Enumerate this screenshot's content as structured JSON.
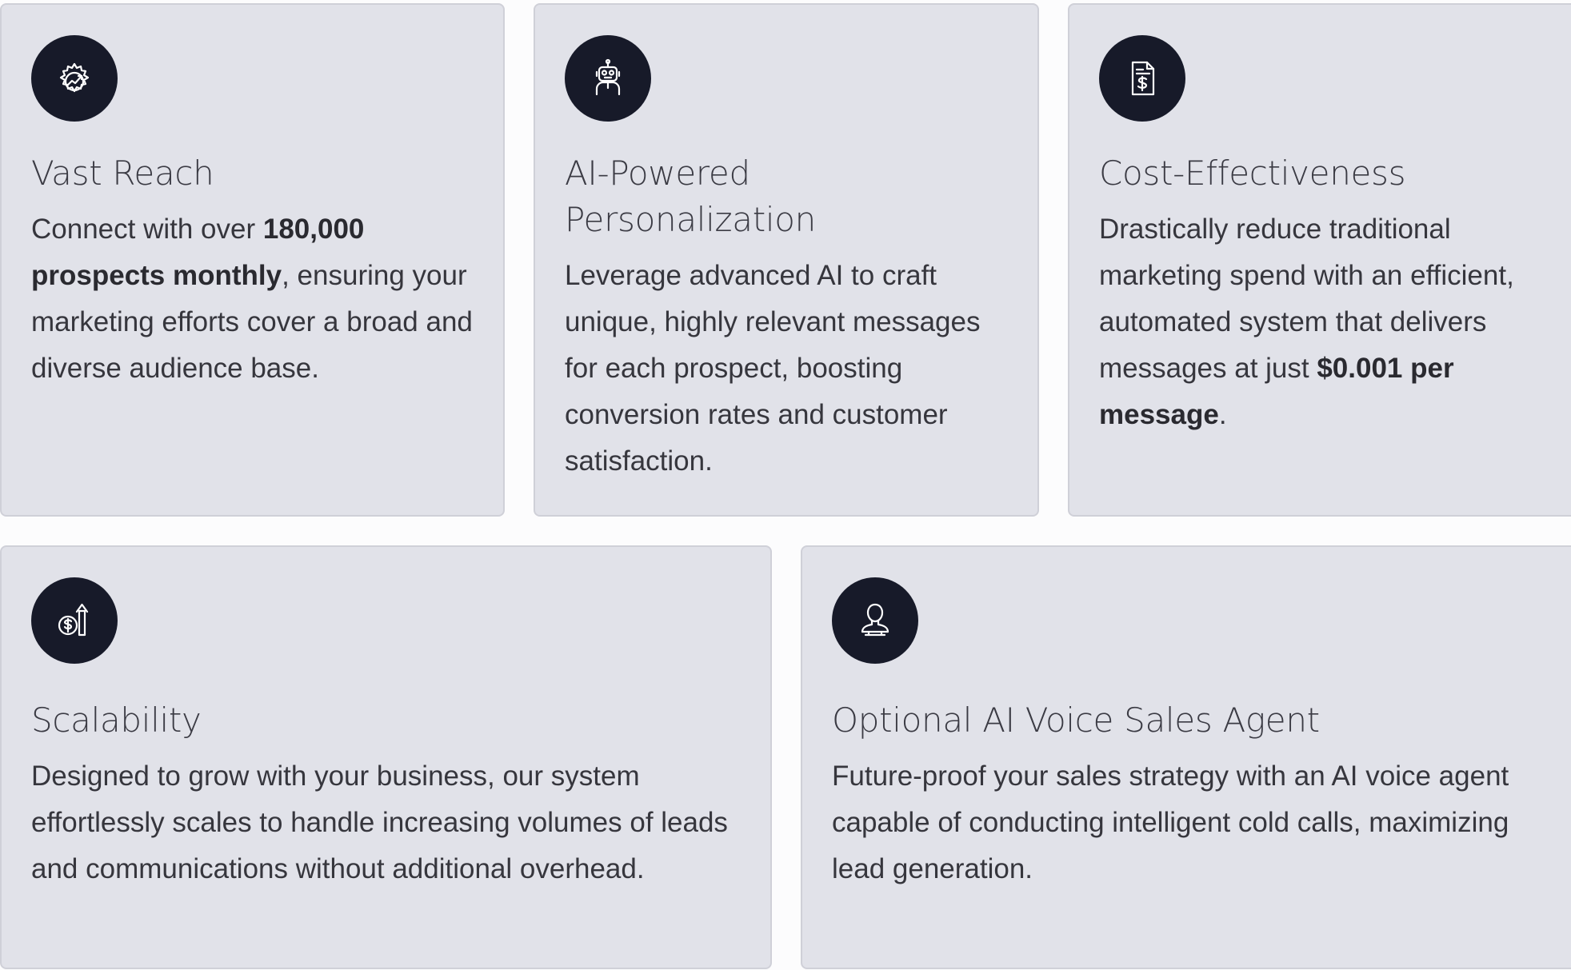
{
  "cards": [
    {
      "icon": "gear-growth-icon",
      "title": "Vast Reach",
      "body": {
        "pre": "Connect with over ",
        "bold": "180,000 prospects monthly",
        "post": ", ensuring your marketing efforts cover a broad and diverse audience base."
      }
    },
    {
      "icon": "robot-icon",
      "title": "AI-Powered Personalization",
      "body": {
        "pre": "Leverage advanced AI to craft unique, highly relevant messages for each prospect, boosting conversion rates and customer satisfaction.",
        "bold": "",
        "post": ""
      }
    },
    {
      "icon": "invoice-dollar-icon",
      "title": "Cost-Effectiveness",
      "body": {
        "pre": "Drastically reduce traditional marketing spend with an efficient, automated system that delivers messages at just ",
        "bold": "$0.001 per message",
        "post": "."
      }
    },
    {
      "icon": "coin-arrow-up-icon",
      "title": "Scalability",
      "body": {
        "pre": "Designed to grow with your business, our system effortlessly scales to handle increasing volumes of leads and communications without additional overhead.",
        "bold": "",
        "post": ""
      }
    },
    {
      "icon": "person-bust-icon",
      "title": "Optional AI Voice Sales Agent",
      "body": {
        "pre": "Future-proof your sales strategy with an AI voice agent capable of conducting intelligent cold calls, maximizing lead generation.",
        "bold": "",
        "post": ""
      }
    }
  ],
  "colors": {
    "card_background": "#e1e2e9",
    "icon_background": "#171a29",
    "text": "#36363d"
  }
}
